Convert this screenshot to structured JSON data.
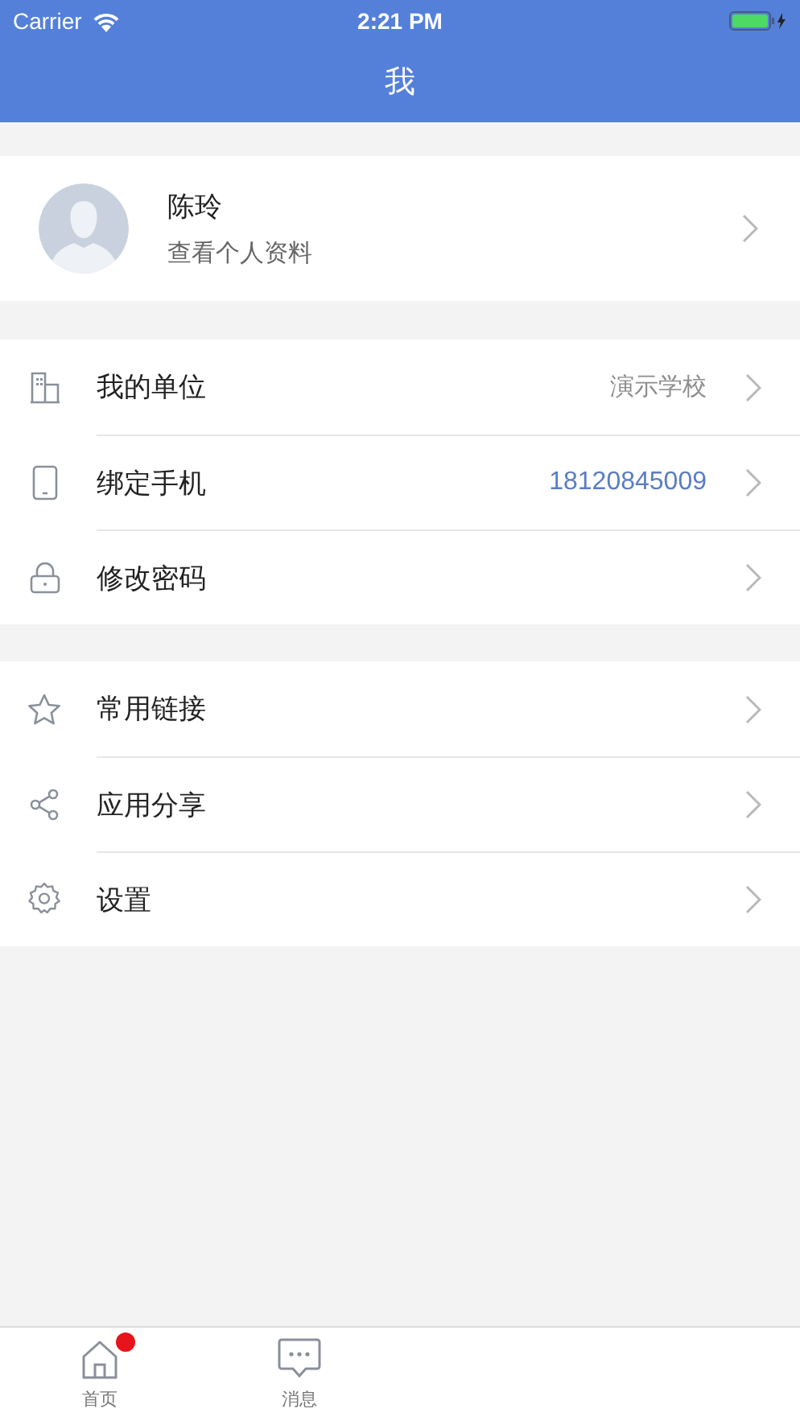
{
  "status_bar": {
    "carrier": "Carrier",
    "time": "2:21 PM"
  },
  "nav": {
    "title": "我"
  },
  "profile": {
    "name": "陈玲",
    "subtitle": "查看个人资料"
  },
  "groups": [
    {
      "rows": [
        {
          "kind": "building",
          "label": "我的单位",
          "value": {
            "text": "演示学校",
            "kind": "plain"
          }
        },
        {
          "kind": "phone",
          "label": "绑定手机",
          "value": {
            "text": "18120845009",
            "kind": "link"
          }
        },
        {
          "kind": "lock",
          "label": "修改密码"
        }
      ]
    },
    {
      "rows": [
        {
          "kind": "star",
          "label": "常用链接"
        },
        {
          "kind": "share",
          "label": "应用分享"
        },
        {
          "kind": "gear",
          "label": "设置"
        }
      ]
    }
  ],
  "tab_bar": [
    {
      "kind": "home",
      "label": "首页",
      "selected": false,
      "badge": true
    },
    {
      "kind": "message",
      "label": "消息",
      "selected": false,
      "badge": false
    }
  ]
}
